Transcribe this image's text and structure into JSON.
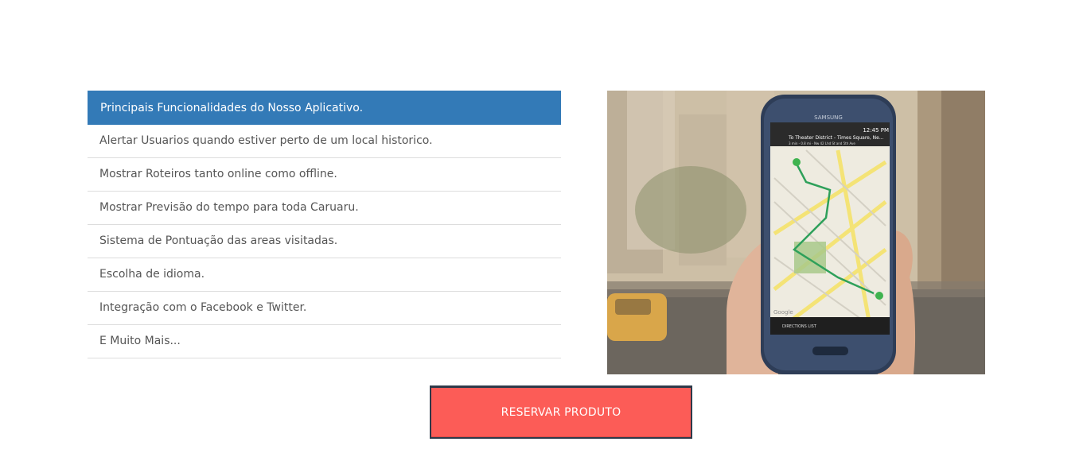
{
  "features": {
    "header": "Principais Funcionalidades do Nosso Aplicativo.",
    "items": [
      "Alertar Usuarios quando estiver perto de um local historico.",
      "Mostrar Roteiros tanto online como offline.",
      "Mostrar Previsão do tempo para toda Caruaru.",
      "Sistema de Pontuação das areas visitadas.",
      "Escolha de idioma.",
      "Integração com o Facebook e Twitter.",
      "E Muito Mais..."
    ]
  },
  "photo": {
    "phone_brand": "SAMSUNG",
    "status_time": "12:45 PM",
    "map_destination": "To Theater District - Times Square, Ne...",
    "map_route_info": "3 min - 0.8 mi - Nw 42 Lhd St and 5th Ave",
    "map_footer": "DIRECTIONS LIST",
    "map_logo": "Google"
  },
  "actions": {
    "reserve_label": "RESERVAR PRODUTO"
  },
  "colors": {
    "list_header_bg": "#337ab7",
    "reserve_button_bg": "#fc5c57",
    "list_divider": "#dddddd"
  }
}
